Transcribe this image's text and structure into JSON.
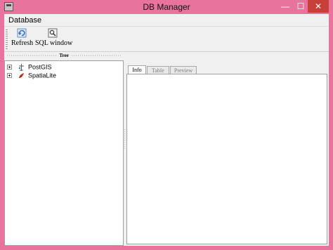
{
  "window": {
    "title": "DB Manager",
    "minimize_glyph": "—",
    "maximize_glyph": "☐",
    "close_glyph": "✕"
  },
  "menu": {
    "items": [
      {
        "label": "Database"
      }
    ]
  },
  "toolbar": {
    "refresh": {
      "label": "Refresh",
      "icon": "refresh-icon"
    },
    "sql_window": {
      "label": "SQL window",
      "icon": "sql-window-icon"
    }
  },
  "tree": {
    "header": "Tree",
    "items": [
      {
        "label": "PostGIS",
        "icon": "postgis-icon"
      },
      {
        "label": "SpatiaLite",
        "icon": "spatialite-icon"
      }
    ]
  },
  "tabs": [
    {
      "label": "Info",
      "active": true
    },
    {
      "label": "Table",
      "active": false
    },
    {
      "label": "Preview",
      "active": false
    }
  ],
  "colors": {
    "frame": "#e8739d",
    "close_button": "#c7403a",
    "client_bg": "#f0f0f0"
  }
}
